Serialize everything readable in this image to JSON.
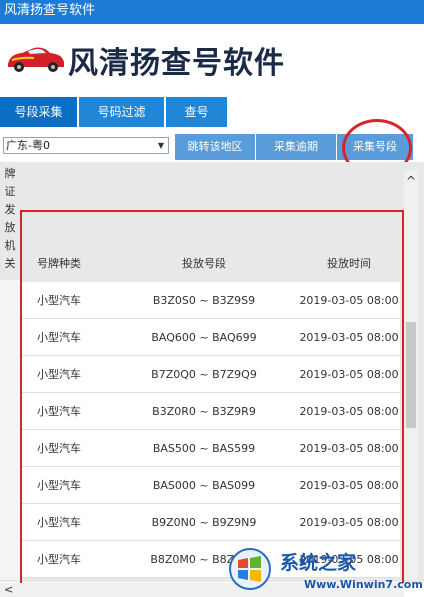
{
  "window": {
    "title": "风清扬查号软件"
  },
  "banner": {
    "title": "风清扬查号软件"
  },
  "tabs": [
    {
      "label": "号段采集",
      "active": true
    },
    {
      "label": "号码过滤",
      "active": false
    },
    {
      "label": "查号",
      "active": false
    }
  ],
  "toolbar": {
    "region_value": "广东-粤0",
    "buttons": [
      "跳转该地区",
      "采集逾期",
      "采集号段"
    ]
  },
  "left_label": [
    "牌",
    "证",
    "发",
    "放",
    "机",
    "关"
  ],
  "table": {
    "headers": [
      "号牌种类",
      "投放号段",
      "投放时间"
    ],
    "rows": [
      [
        "小型汽车",
        "B3Z0S0 ~ B3Z9S9",
        "2019-03-05 08:00"
      ],
      [
        "小型汽车",
        "BAQ600 ~ BAQ699",
        "2019-03-05 08:00"
      ],
      [
        "小型汽车",
        "B7Z0Q0 ~ B7Z9Q9",
        "2019-03-05 08:00"
      ],
      [
        "小型汽车",
        "B3Z0R0 ~ B3Z9R9",
        "2019-03-05 08:00"
      ],
      [
        "小型汽车",
        "BAS500 ~ BAS599",
        "2019-03-05 08:00"
      ],
      [
        "小型汽车",
        "BAS000 ~ BAS099",
        "2019-03-05 08:00"
      ],
      [
        "小型汽车",
        "B9Z0N0 ~ B9Z9N9",
        "2019-03-05 08:00"
      ],
      [
        "小型汽车",
        "B8Z0M0 ~ B8Z9M9",
        "2019-03-05 08:00"
      ]
    ]
  },
  "watermark": {
    "text": "系统之家",
    "url": "Www.Winwin7.com"
  },
  "colors": {
    "accent": "#1c7bd4",
    "highlight": "#d6242a"
  }
}
